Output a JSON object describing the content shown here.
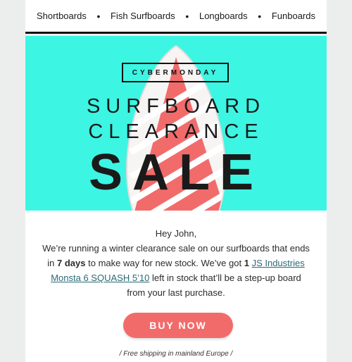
{
  "nav": {
    "items": [
      {
        "label": "Shortboards"
      },
      {
        "label": "Fish Surfboards"
      },
      {
        "label": "Longboards"
      },
      {
        "label": "Funboards"
      }
    ],
    "separator": "•"
  },
  "hero": {
    "badge": "CYBERMONDAY",
    "line1": "SURFBOARD",
    "line2": "CLEARANCE",
    "sale": "SALE",
    "background_color": "#3df5e3",
    "board_color": "#f26b6b"
  },
  "message": {
    "greeting": "Hey John,",
    "text_part1": "We’re running a winter clearance sale on our surfboards that ends in",
    "days_bold": "7 days",
    "text_part2": "to make way for new stock. We’ve got",
    "count_bold": "1",
    "product_link": "JS Industries Monsta 6 SQUASH 5’10",
    "text_part3": "left in stock that’ll be a step-up board from your last purchase."
  },
  "cta": {
    "label": "BUY NOW",
    "color": "#f26b6b"
  },
  "footer": {
    "shipping_note": "/ Free shipping in mainland Europe /"
  }
}
